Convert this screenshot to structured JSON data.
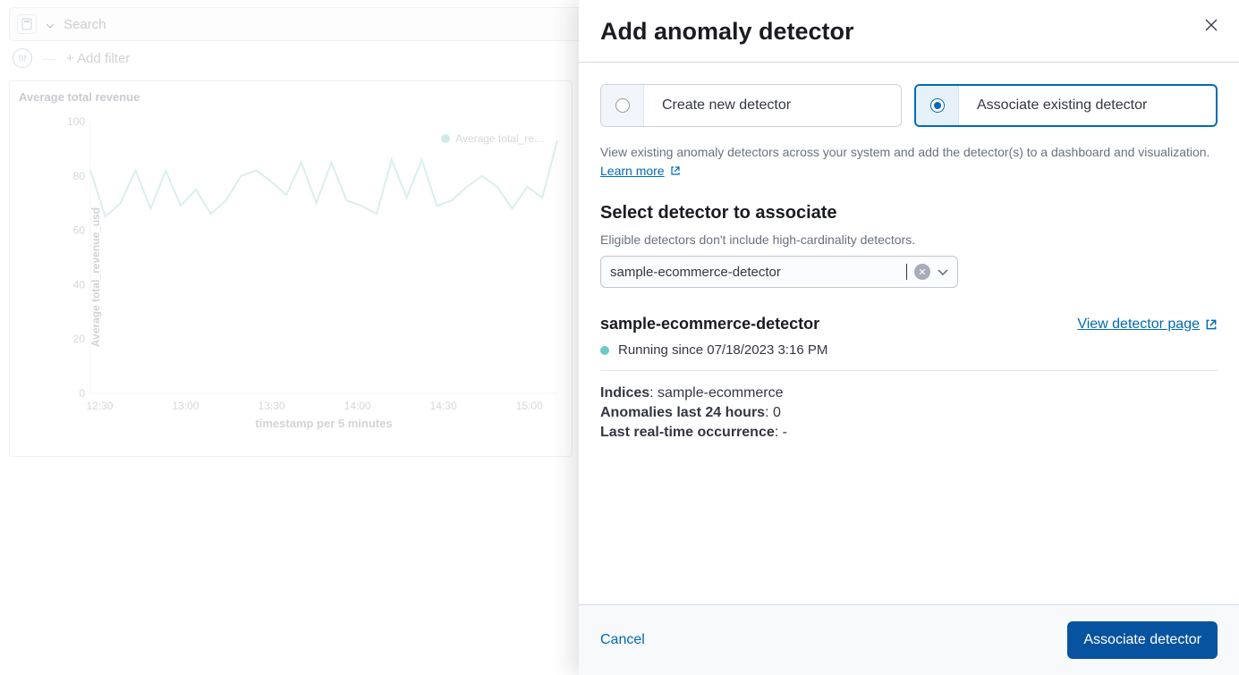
{
  "topbar": {
    "search_placeholder": "Search"
  },
  "filterbar": {
    "add_filter": "+ Add filter"
  },
  "panel": {
    "title": "Average total revenue",
    "legend": "Average total_re…"
  },
  "chart_data": {
    "type": "line",
    "title": "Average total revenue",
    "ylabel": "Average total_revenue_usd",
    "xlabel": "timestamp per 5 minutes",
    "ylim": [
      0,
      100
    ],
    "y_ticks": [
      0,
      20,
      40,
      60,
      80,
      100
    ],
    "x_categories": [
      "12:30",
      "13:00",
      "13:30",
      "14:00",
      "14:30",
      "15:00"
    ],
    "x": [
      0,
      1,
      2,
      3,
      4,
      5,
      6,
      7,
      8,
      9,
      10,
      11,
      12,
      13,
      14,
      15,
      16,
      17,
      18,
      19,
      20,
      21,
      22,
      23,
      24,
      25,
      26,
      27,
      28,
      29,
      30,
      31
    ],
    "values": [
      82,
      65,
      70,
      82,
      68,
      82,
      69,
      75,
      66,
      71,
      80,
      82,
      78,
      73,
      85,
      70,
      85,
      71,
      69,
      66,
      86,
      72,
      86,
      69,
      71,
      76,
      80,
      76,
      68,
      76,
      72,
      93
    ]
  },
  "flyout": {
    "title": "Add anomaly detector",
    "radio_create": "Create new detector",
    "radio_assoc": "Associate existing detector",
    "hint": "View existing anomaly detectors across your system and add the detector(s) to a dashboard and visualization.",
    "learn_more": "Learn more",
    "select_h": "Select detector to associate",
    "eligible_note": "Eligible detectors don't include high-cardinality detectors.",
    "combo_value": "sample-ecommerce-detector",
    "detector": {
      "name": "sample-ecommerce-detector",
      "view_link": "View detector page",
      "status": "Running since 07/18/2023 3:16 PM",
      "indices_label": "Indices",
      "indices_value": "sample-ecommerce",
      "anomalies_label": "Anomalies last 24 hours",
      "anomalies_value": "0",
      "last_label": "Last real-time occurrence",
      "last_value": "-"
    },
    "cancel": "Cancel",
    "submit": "Associate detector"
  }
}
